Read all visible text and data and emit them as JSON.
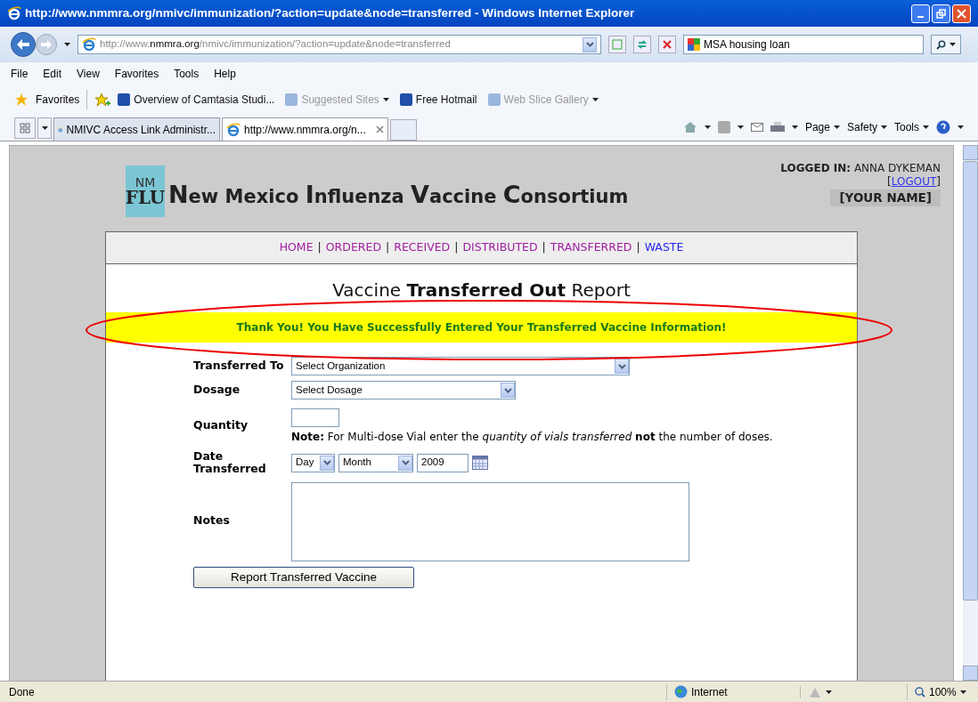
{
  "window": {
    "title": "http://www.nmmra.org/nmivc/immunization/?action=update&node=transferred - Windows Internet Explorer"
  },
  "address_bar": {
    "url_prefix": "http://www.",
    "url_domain": "nmmra.org",
    "url_path": "/nmivc/immunization/?action=update&node=transferred",
    "search_value": "MSA housing loan"
  },
  "menu": [
    "File",
    "Edit",
    "View",
    "Favorites",
    "Tools",
    "Help"
  ],
  "favorites_bar": {
    "label": "Favorites",
    "items": [
      {
        "label": "Overview of Camtasia Studi...",
        "dimmed": false,
        "dropdown": false
      },
      {
        "label": "Suggested Sites",
        "dimmed": true,
        "dropdown": true
      },
      {
        "label": "Free Hotmail",
        "dimmed": false,
        "dropdown": false
      },
      {
        "label": "Web Slice Gallery",
        "dimmed": true,
        "dropdown": true
      }
    ]
  },
  "tabs": [
    {
      "label": "NMIVC Access Link Administr...",
      "selected": false
    },
    {
      "label": "http://www.nmmra.org/n...",
      "selected": true
    }
  ],
  "command_bar": [
    "Page",
    "Safety",
    "Tools"
  ],
  "page": {
    "logo": {
      "top": "NM",
      "bottom": "FLU"
    },
    "site_title": [
      {
        "cap": "N",
        "rest": "ew Mexico "
      },
      {
        "cap": "I",
        "rest": "nfluenza "
      },
      {
        "cap": "V",
        "rest": "accine "
      },
      {
        "cap": "C",
        "rest": "onsortium"
      }
    ],
    "login": {
      "label": "LOGGED IN:",
      "user": "ANNA DYKEMAN",
      "open": "[",
      "logout": "LOGOUT",
      "close": "]",
      "name": "[YOUR NAME]"
    },
    "nav": [
      {
        "label": "HOME",
        "visited": true
      },
      {
        "label": "ORDERED",
        "visited": true
      },
      {
        "label": "RECEIVED",
        "visited": true
      },
      {
        "label": "DISTRIBUTED",
        "visited": true
      },
      {
        "label": "TRANSFERRED",
        "visited": true
      },
      {
        "label": "WASTE",
        "visited": false
      }
    ],
    "nav_separator": "|",
    "heading": "Vaccine **Transferred Out** Report",
    "success_message": "Thank You! You Have Successfully Entered Your Transferred Vaccine Information!",
    "form": {
      "transferred_to": {
        "label": "Transferred To",
        "value": "Select Organization"
      },
      "dosage": {
        "label": "Dosage",
        "value": "Select Dosage"
      },
      "quantity": {
        "label": "Quantity",
        "note": "**Note:** For Multi-dose Vial enter the *quantity of vials transferred* **not** the number of doses."
      },
      "date": {
        "label": "Date Transferred",
        "day": "Day",
        "month": "Month",
        "year": "2009"
      },
      "notes": {
        "label": "Notes"
      },
      "submit": "Report Transferred Vaccine"
    }
  },
  "status_bar": {
    "text": "Done",
    "zone": "Internet",
    "zoom": "100%"
  }
}
